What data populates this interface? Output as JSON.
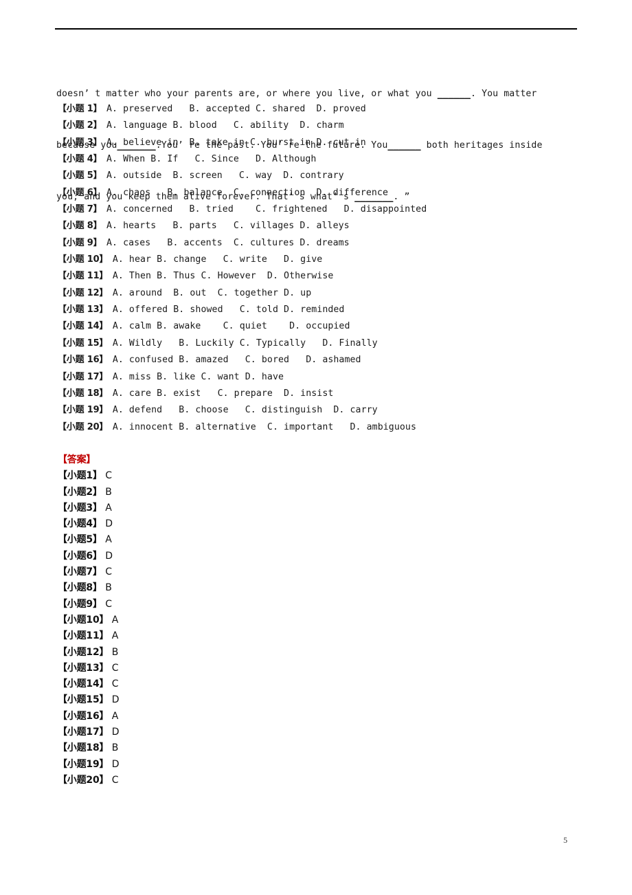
{
  "page": {
    "page_number": "5",
    "rule_color": "#000000",
    "answer_header_color": "#c00000"
  },
  "passage": {
    "lines": [
      "doesn’ t matter who your parents are, or where you live, or what you  ",
      "because you",
      "you, and you keep them alive forever. That’ s what’ s  "
    ],
    "line1_pre": "doesn’ t matter who your parents are, or where you live, or what you ",
    "line1_blank": "______",
    "line1_post": ". You matter",
    "line2_pre": "because you",
    "line2_blank_a": "_______",
    "line2_mid": ".You’ re the past. You’ re the future. You",
    "line2_blank_b": "______",
    "line2_post": " both heritages inside",
    "line3_pre": "you, and you keep them alive forever. That’ s what’ s ",
    "line3_blank": "_______",
    "line3_post": ". ”"
  },
  "questions": [
    {
      "label": "【小题 1】",
      "options": "A. preserved   B. accepted C. shared  D. proved"
    },
    {
      "label": "【小题 2】",
      "options": "A. language B. blood   C. ability  D. charm"
    },
    {
      "label": "【小题 3】",
      "options": "A. believe in  B. take in C. burst in D. cut in"
    },
    {
      "label": "【小题 4】",
      "options": "A. When B. If   C. Since   D. Although"
    },
    {
      "label": "【小题 5】",
      "options": "A. outside  B. screen   C. way  D. contrary"
    },
    {
      "label": "【小题 6】",
      "options": "A. chaos   B. balance  C. connection  D. difference"
    },
    {
      "label": "【小题 7】",
      "options": "A. concerned   B. tried    C. frightened   D. disappointed"
    },
    {
      "label": "【小题 8】",
      "options": "A. hearts   B. parts   C. villages D. alleys"
    },
    {
      "label": "【小题 9】",
      "options": "A. cases   B. accents  C. cultures D. dreams"
    },
    {
      "label": "【小题 10】",
      "options": "A. hear B. change   C. write   D. give"
    },
    {
      "label": "【小题 11】",
      "options": "A. Then B. Thus C. However  D. Otherwise"
    },
    {
      "label": "【小题 12】",
      "options": "A. around  B. out  C. together D. up"
    },
    {
      "label": "【小题 13】",
      "options": "A. offered B. showed   C. told D. reminded"
    },
    {
      "label": "【小题 14】",
      "options": "A. calm B. awake    C. quiet    D. occupied"
    },
    {
      "label": "【小题 15】",
      "options": "A. Wildly   B. Luckily C. Typically   D. Finally"
    },
    {
      "label": "【小题 16】",
      "options": "A. confused B. amazed   C. bored   D. ashamed"
    },
    {
      "label": "【小题 17】",
      "options": "A. miss B. like C. want D. have"
    },
    {
      "label": "【小题 18】",
      "options": "A. care B. exist   C. prepare  D. insist"
    },
    {
      "label": "【小题 19】",
      "options": "A. defend   B. choose   C. distinguish  D. carry"
    },
    {
      "label": "【小题 20】",
      "options": "A. innocent B. alternative  C. important   D. ambiguous"
    }
  ],
  "answers": {
    "header": "【答案】",
    "items": [
      {
        "label": "【小题1】",
        "value": "C"
      },
      {
        "label": "【小题2】",
        "value": "B"
      },
      {
        "label": "【小题3】",
        "value": "A"
      },
      {
        "label": "【小题4】",
        "value": "D"
      },
      {
        "label": "【小题5】",
        "value": "A"
      },
      {
        "label": "【小题6】",
        "value": "D"
      },
      {
        "label": "【小题7】",
        "value": "C"
      },
      {
        "label": "【小题8】",
        "value": "B"
      },
      {
        "label": "【小题9】",
        "value": "C"
      },
      {
        "label": "【小题10】",
        "value": "A"
      },
      {
        "label": "【小题11】",
        "value": "A"
      },
      {
        "label": "【小题12】",
        "value": "B"
      },
      {
        "label": "【小题13】",
        "value": "C"
      },
      {
        "label": "【小题14】",
        "value": "C"
      },
      {
        "label": "【小题15】",
        "value": "D"
      },
      {
        "label": "【小题16】",
        "value": "A"
      },
      {
        "label": "【小题17】",
        "value": "D"
      },
      {
        "label": "【小题18】",
        "value": "B"
      },
      {
        "label": "【小题19】",
        "value": "D"
      },
      {
        "label": "【小题20】",
        "value": "C"
      }
    ]
  }
}
